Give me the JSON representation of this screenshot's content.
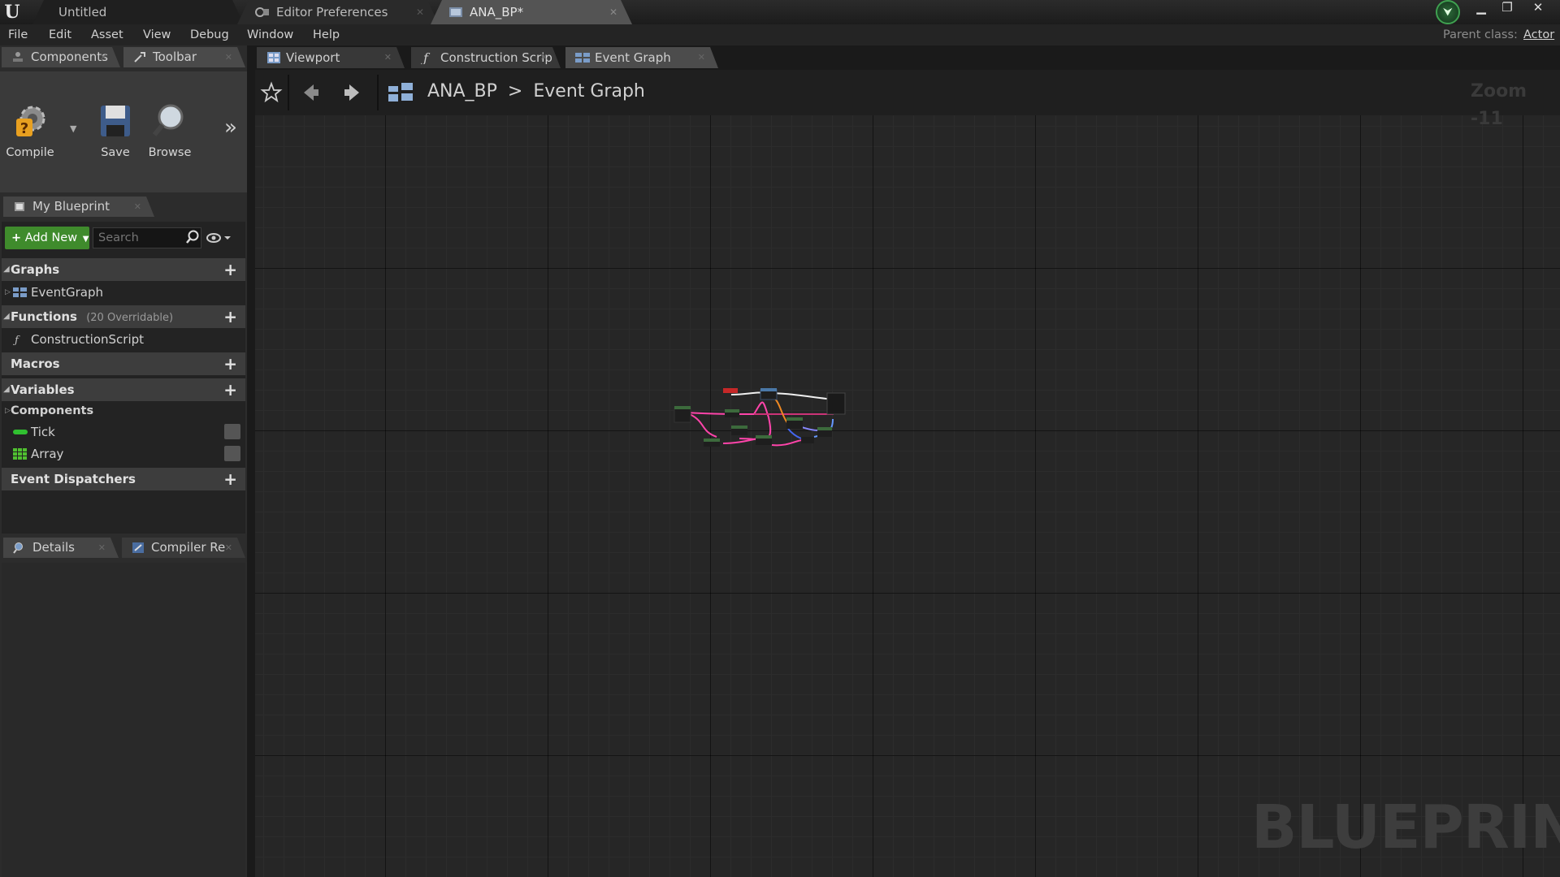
{
  "window": {
    "tabs": [
      {
        "label": "Untitled"
      },
      {
        "label": "Editor Preferences"
      },
      {
        "label": "ANA_BP*"
      }
    ]
  },
  "menu": {
    "items": [
      "File",
      "Edit",
      "Asset",
      "View",
      "Debug",
      "Window",
      "Help"
    ],
    "parent_class_label": "Parent class:",
    "parent_class_value": "Actor"
  },
  "panels": {
    "top_tabs": [
      "Components",
      "Toolbar"
    ],
    "toolbar": {
      "compile": "Compile",
      "save": "Save",
      "browse": "Browse"
    },
    "my_blueprint": {
      "tab": "My Blueprint",
      "add_new": "Add New",
      "search_placeholder": "Search",
      "graphs": {
        "label": "Graphs",
        "items": [
          "EventGraph"
        ]
      },
      "functions": {
        "label": "Functions",
        "note": "(20 Overridable)",
        "items": [
          "ConstructionScript"
        ]
      },
      "macros": {
        "label": "Macros"
      },
      "variables": {
        "label": "Variables",
        "components_label": "Components",
        "items": [
          {
            "name": "Tick",
            "color": "#30c030"
          },
          {
            "name": "Array",
            "color": "#50c030"
          }
        ]
      },
      "event_dispatchers": {
        "label": "Event Dispatchers"
      }
    },
    "bottom_tabs": [
      "Details",
      "Compiler Re"
    ]
  },
  "graph": {
    "tabs": [
      "Viewport",
      "Construction Scrip",
      "Event Graph"
    ],
    "breadcrumb": {
      "asset": "ANA_BP",
      "separator": ">",
      "graph": "Event Graph"
    },
    "zoom": "Zoom -11",
    "watermark": "BLUEPRINT"
  }
}
